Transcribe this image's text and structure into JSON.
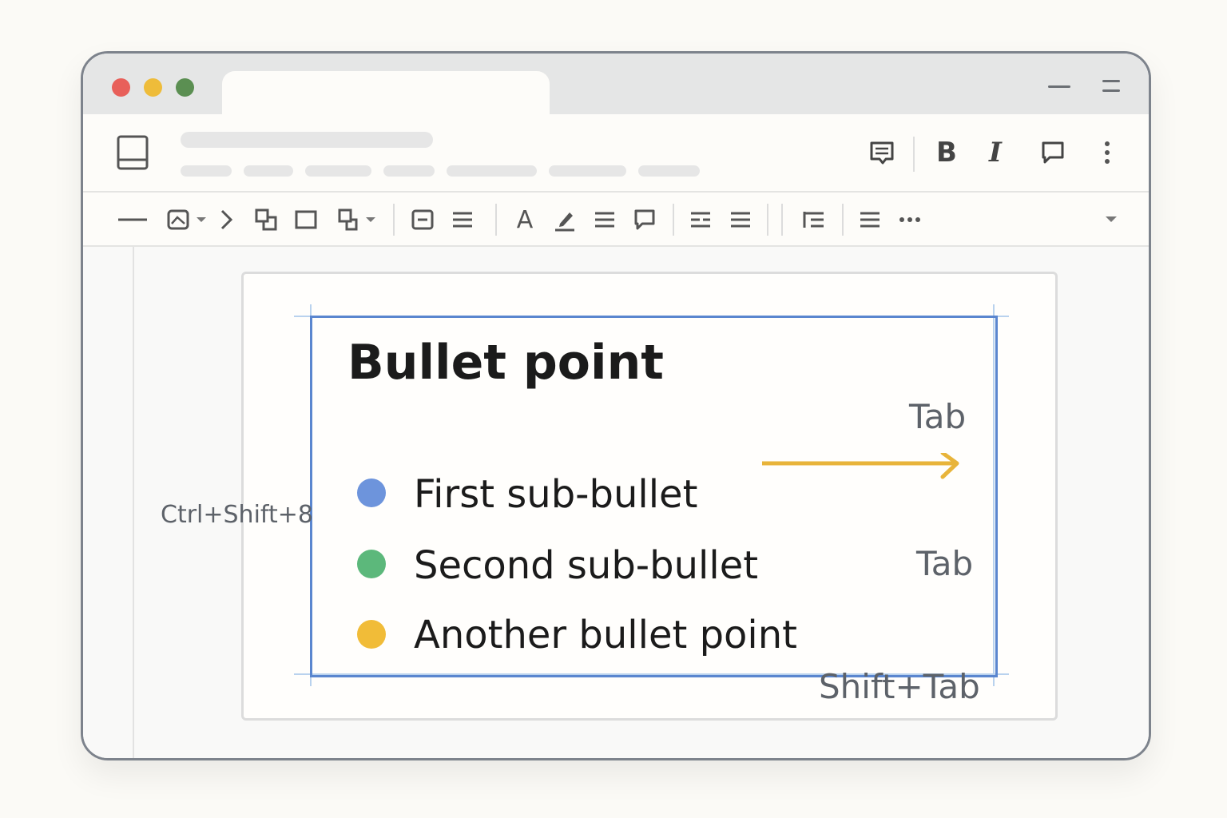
{
  "toolbar_right": {
    "bold_label": "B",
    "italic_label": "I"
  },
  "format_toolbar": {
    "text_color_label": "A"
  },
  "slide": {
    "heading": "Bullet point",
    "bullets": [
      {
        "text": "First sub-bullet",
        "color": "#6d94dc"
      },
      {
        "text": "Second sub-bullet",
        "color": "#5cb87b"
      },
      {
        "text": "Another bullet point",
        "color": "#f1bc38"
      }
    ],
    "shortcut_left": "Ctrl+Shift+8",
    "shortcut_tab_1": "Tab",
    "shortcut_tab_2": "Tab",
    "shortcut_shift_tab": "Shift+Tab",
    "arrow_color": "#e8b43a",
    "textbox_border_color": "#5a86cf"
  },
  "icons": [
    "document-icon",
    "comment-icon",
    "bold-icon",
    "italic-icon",
    "speech-bubble-icon",
    "more-vert-icon",
    "line-icon",
    "image-icon",
    "chevron-right-icon",
    "arrange-icon",
    "rectangle-icon",
    "shape-icon",
    "text-box-icon",
    "align-icon",
    "text-color-icon",
    "highlight-icon",
    "paragraph-icon",
    "comment-icon",
    "align-left-icon",
    "align-justify-icon",
    "indent-icon",
    "bulleted-list-icon",
    "more-horiz-icon",
    "dropdown-icon"
  ]
}
